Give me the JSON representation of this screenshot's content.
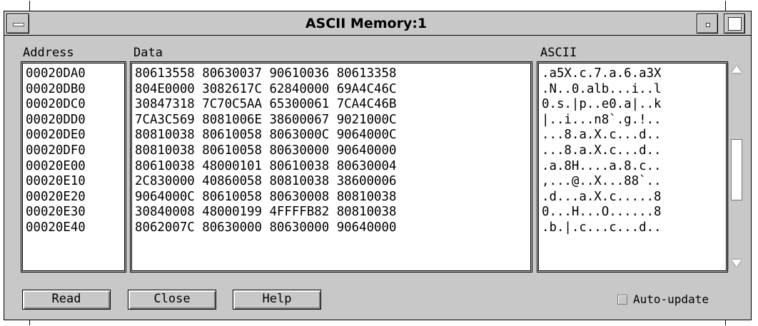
{
  "window": {
    "title": "ASCII Memory:1"
  },
  "columns": {
    "address": "Address",
    "data": "Data",
    "ascii": "ASCII"
  },
  "rows": [
    {
      "address": "00020DA0",
      "data": "80613558 80630037 90610036 80613358",
      "ascii": ".a5X.c.7.a.6.a3X"
    },
    {
      "address": "00020DB0",
      "data": "804E0000 3082617C 62840000 69A4C46C",
      "ascii": ".N..0.alb...i..l"
    },
    {
      "address": "00020DC0",
      "data": "30847318 7C70C5AA 65300061 7CA4C46B",
      "ascii": "0.s.|p..e0.a|..k"
    },
    {
      "address": "00020DD0",
      "data": "7CA3C569 8081006E 38600067 9021000C",
      "ascii": "|..i...n8`.g.!.."
    },
    {
      "address": "00020DE0",
      "data": "80810038 80610058 8063000C 9064000C",
      "ascii": "...8.a.X.c...d.."
    },
    {
      "address": "00020DF0",
      "data": "80810038 80610058 80630000 90640000",
      "ascii": "...8.a.X.c...d.."
    },
    {
      "address": "00020E00",
      "data": "80610038 48000101 80610038 80630004",
      "ascii": ".a.8H....a.8.c.."
    },
    {
      "address": "00020E10",
      "data": "2C830000 40860058 80810038 38600006",
      "ascii": ",...@..X...88`.."
    },
    {
      "address": "00020E20",
      "data": "9064000C 80610058 80630008 80810038",
      "ascii": ".d...a.X.c.....8"
    },
    {
      "address": "00020E30",
      "data": "30840008 48000199 4FFFFB82 80810038",
      "ascii": "0...H...O......8"
    },
    {
      "address": "00020E40",
      "data": "8062007C 80630000 80630000 90640000",
      "ascii": ".b.|.c...c...d.."
    }
  ],
  "buttons": {
    "read": "Read",
    "close": "Close",
    "help": "Help"
  },
  "auto_update": {
    "label": "Auto-update",
    "checked": false
  }
}
